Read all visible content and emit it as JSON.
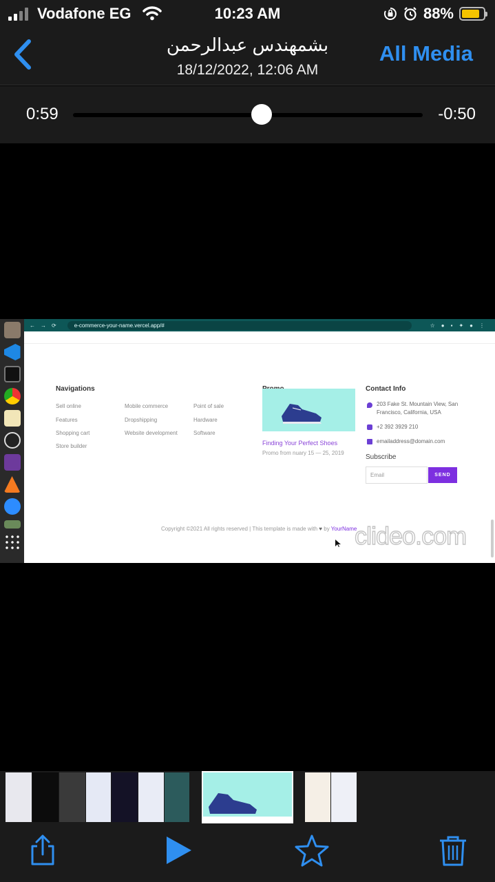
{
  "status_bar": {
    "carrier": "Vodafone EG",
    "time": "10:23 AM",
    "battery_percent": "88%"
  },
  "nav": {
    "title": "بشمهندس عبدالرحمن",
    "subtitle": "18/12/2022, 12:06 AM",
    "all_media": "All Media"
  },
  "scrubber": {
    "elapsed": "0:59",
    "remaining": "-0:50",
    "progress": 0.54
  },
  "video": {
    "browser_url": "e-commerce-your-name.vercel.app/#",
    "navigations_title": "Navigations",
    "nav_col1": [
      "Sell online",
      "Features",
      "Shopping cart",
      "Store builder"
    ],
    "nav_col2": [
      "Mobile commerce",
      "Dropshipping",
      "Website development"
    ],
    "nav_col3": [
      "Point of sale",
      "Hardware",
      "Software"
    ],
    "promo_title": "Promo",
    "promo_link": "Finding Your Perfect Shoes",
    "promo_sub": "Promo from nuary 15 — 25, 2019",
    "contact_title": "Contact Info",
    "address_line1": "203 Fake St. Mountain View, San",
    "address_line2": "Francisco, California, USA",
    "phone": "+2 392 3929 210",
    "email": "emailaddress@domain.com",
    "subscribe_title": "Subscribe",
    "email_placeholder": "Email",
    "send_label": "SEND",
    "copyright_pre": "Copyright ©2021 All rights reserved | This template is made with",
    "copyright_by": "by",
    "copyright_name": "YourName",
    "watermark": "clideo.com"
  },
  "colors": {
    "accent": "#2f8ff0",
    "chrome": "#1b1b1b",
    "promo_bg": "#a5efe7",
    "brand_purple": "#7d2fe0"
  },
  "toolbar": {
    "icons": [
      "share-icon",
      "play-icon",
      "favorite-star-icon",
      "trash-icon"
    ]
  }
}
